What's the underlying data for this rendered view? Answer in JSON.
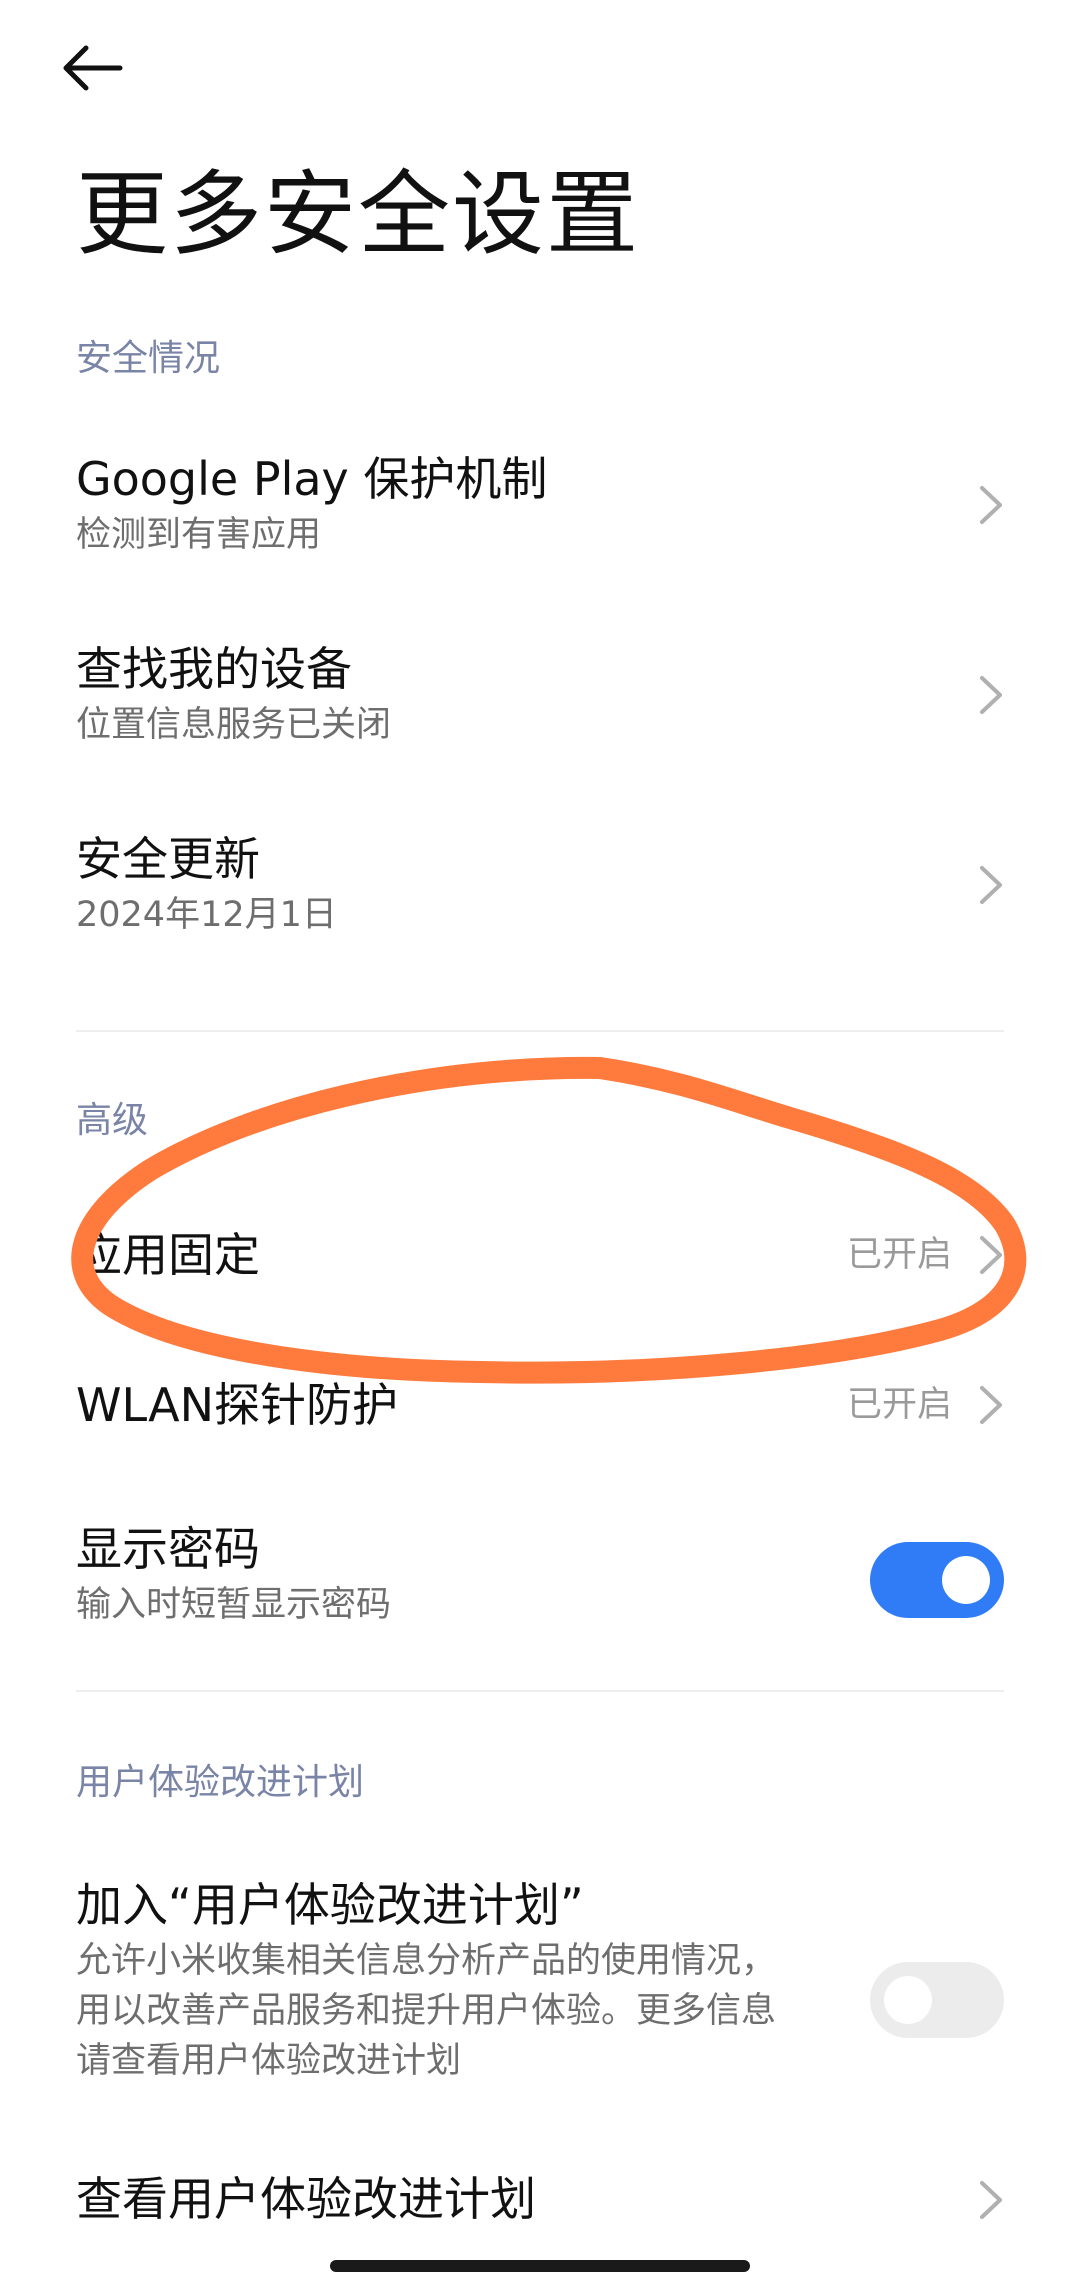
{
  "header": {
    "back_icon": "arrow-left-icon",
    "title": "更多安全设置"
  },
  "sections": {
    "security_status": {
      "header": "安全情况",
      "items": [
        {
          "title": "Google Play 保护机制",
          "subtitle": "检测到有害应用",
          "icon": "chevron-right-icon"
        },
        {
          "title": "查找我的设备",
          "subtitle": "位置信息服务已关闭",
          "icon": "chevron-right-icon"
        },
        {
          "title": "安全更新",
          "subtitle": "2024年12月1日",
          "icon": "chevron-right-icon"
        }
      ]
    },
    "advanced": {
      "header": "高级",
      "items": [
        {
          "title": "应用固定",
          "value": "已开启",
          "icon": "chevron-right-icon"
        },
        {
          "title": "WLAN探针防护",
          "value": "已开启",
          "icon": "chevron-right-icon"
        },
        {
          "title": "显示密码",
          "subtitle": "输入时短暂显示密码",
          "toggle_on": true
        }
      ]
    },
    "ux_program": {
      "header": "用户体验改进计划",
      "items": [
        {
          "title": "加入“用户体验改进计划”",
          "subtitle_lines": [
            "允许小米收集相关信息分析产品的使用情况，",
            "用以改善产品服务和提升用户体验。更多信息",
            "请查看用户体验改进计划"
          ],
          "toggle_on": false
        },
        {
          "title": "查看用户体验改进计划",
          "icon": "chevron-right-icon"
        }
      ]
    }
  },
  "colors": {
    "accent": "#2f7cf6",
    "section_header": "#7a84a6",
    "annotation": "#ff7a3d"
  }
}
